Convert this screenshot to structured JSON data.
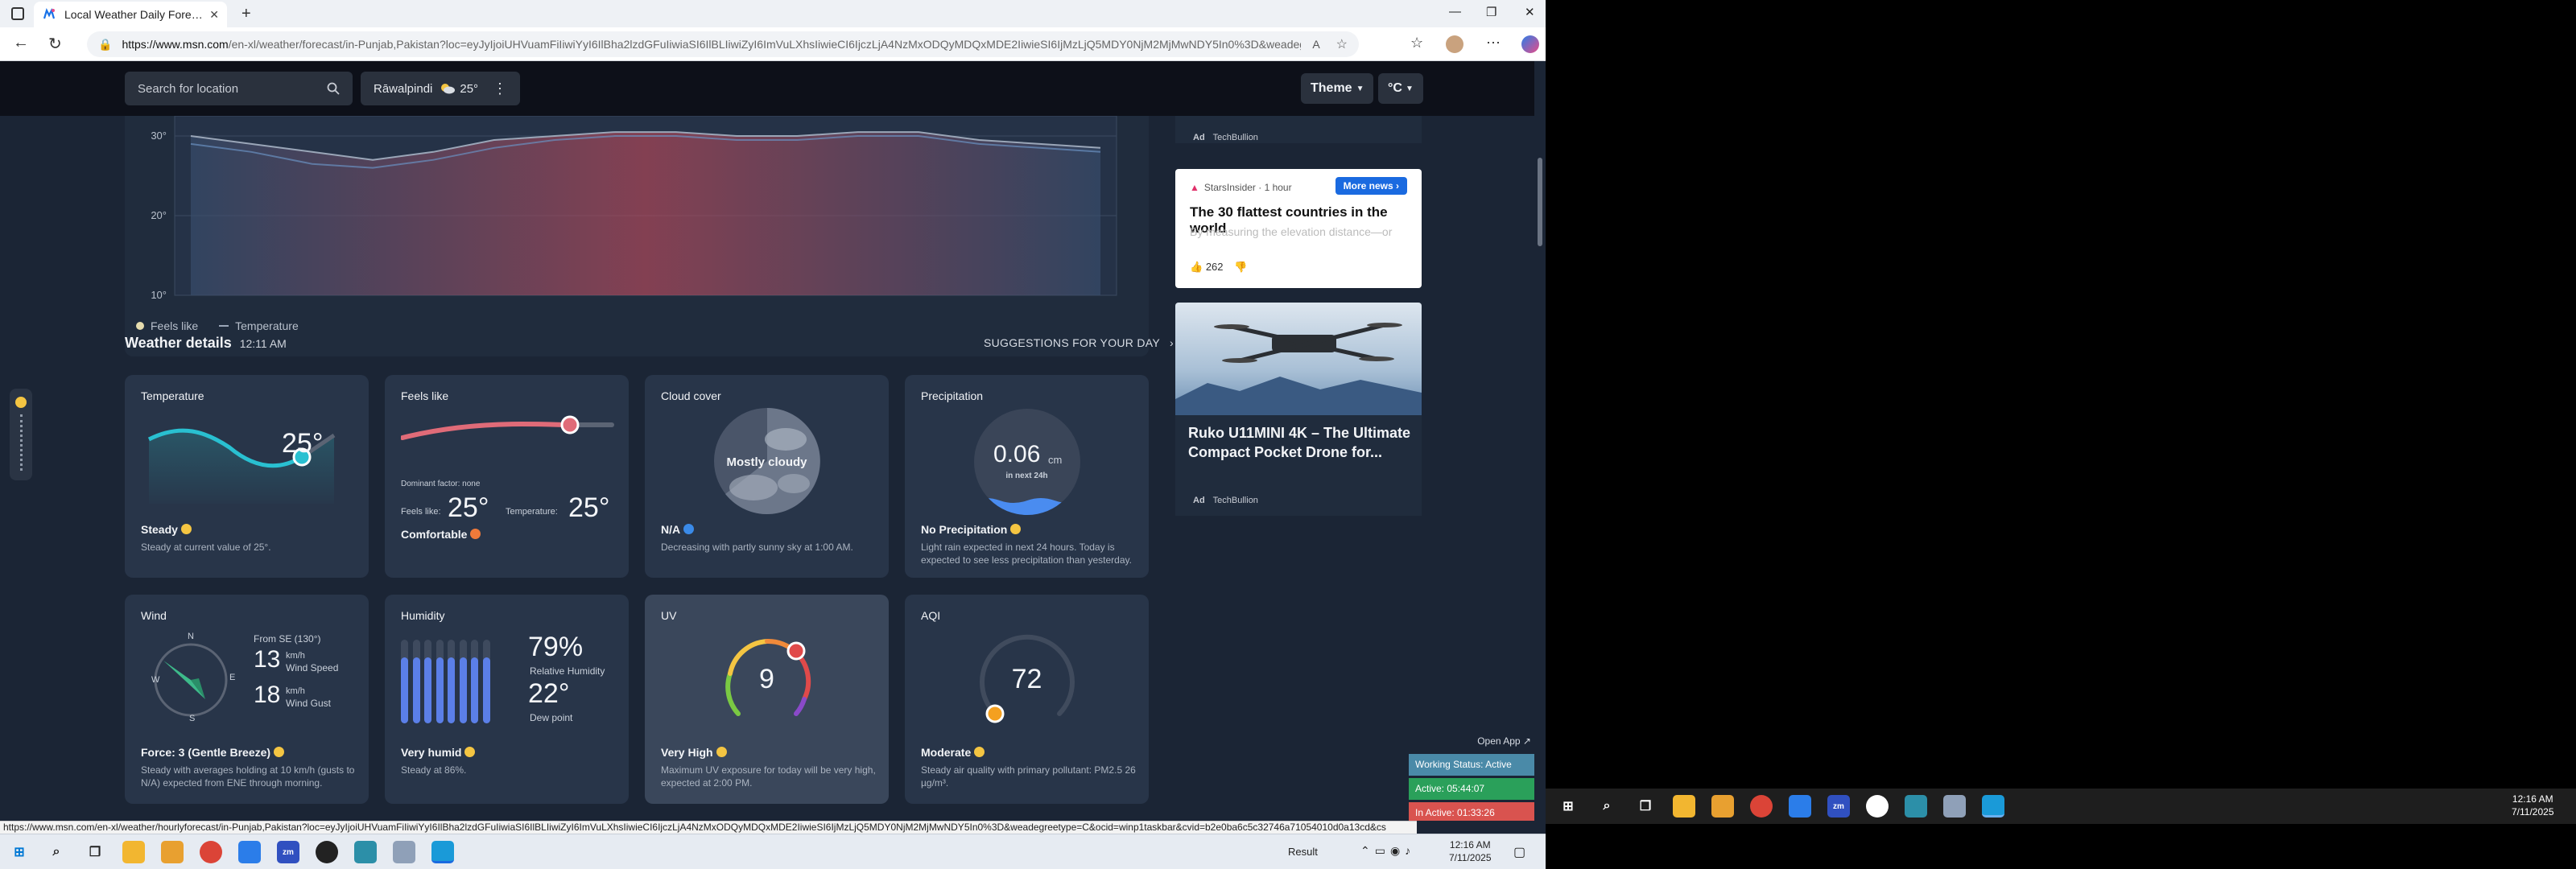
{
  "browser": {
    "tab_title": "Local Weather Daily Forecasts, Ra",
    "tab_close": "✕",
    "new_tab": "+",
    "url_host": "https://www.msn.com",
    "url_path": "/en-xl/weather/forecast/in-Punjab,Pakistan?loc=eyJyIjoiUHVuamFiIiwiYyI6IlBha2lzdGFuIiwiaSI6IlBLIiwiZyI6ImVuLXhsIiwieCI6IjczLjA4NzMxODQyMDQxMDE2IiwieSI6IjMzLjQ5MDY0NjM2MjMwNDY5In0%3D&weadegreet..."
  },
  "header": {
    "search_placeholder": "Search for location",
    "location": "Rāwalpindi",
    "location_temp": "25°",
    "theme_label": "Theme",
    "unit_label": "°C"
  },
  "chart_data": {
    "type": "area",
    "y_ticks": [
      "10°",
      "20°",
      "30°"
    ],
    "ylim": [
      10,
      30
    ],
    "series": [
      {
        "name": "Feels like",
        "values": [
          30,
          29,
          28,
          27,
          28,
          29.5,
          30,
          30.5,
          30.5,
          30,
          30,
          30.5,
          30.5,
          29.5,
          29,
          28.5
        ]
      },
      {
        "name": "Temperature",
        "values": [
          29,
          28,
          26.5,
          26,
          27,
          28.5,
          29.5,
          30,
          30,
          29.5,
          29.5,
          30,
          30,
          29,
          28.5,
          28
        ]
      }
    ],
    "legend": [
      "Feels like",
      "Temperature"
    ]
  },
  "section": {
    "title": "Weather details",
    "time": "12:11 AM",
    "suggestions": "SUGGESTIONS FOR YOUR DAY"
  },
  "cards": {
    "temperature": {
      "title": "Temperature",
      "value": "25°",
      "status": "Steady",
      "desc": "Steady at current value of 25°."
    },
    "feels_like": {
      "title": "Feels like",
      "dominant": "Dominant factor: none",
      "feels_label": "Feels like:",
      "feels_value": "25°",
      "temp_label": "Temperature:",
      "temp_value": "25°",
      "status": "Comfortable"
    },
    "cloud": {
      "title": "Cloud cover",
      "center": "Mostly cloudy",
      "status": "N/A",
      "desc": "Decreasing with partly sunny sky at 1:00 AM."
    },
    "precip": {
      "title": "Precipitation",
      "value": "0.06",
      "unit": "cm",
      "sub": "in next 24h",
      "status": "No Precipitation",
      "desc": "Light rain expected in next 24 hours. Today is expected to see less precipitation than yesterday."
    },
    "wind": {
      "title": "Wind",
      "from": "From SE (130°)",
      "speed": "13",
      "speed_unit": "km/h",
      "speed_label": "Wind Speed",
      "gust": "18",
      "gust_unit": "km/h",
      "gust_label": "Wind Gust",
      "n": "N",
      "s": "S",
      "e": "E",
      "w": "W",
      "status": "Force: 3 (Gentle Breeze)",
      "desc": "Steady with averages holding at 10 km/h (gusts to N/A) expected from ENE through morning."
    },
    "humidity": {
      "title": "Humidity",
      "value": "79%",
      "label": "Relative Humidity",
      "dew": "22°",
      "dew_label": "Dew point",
      "status": "Very humid",
      "desc": "Steady at 86%.",
      "level": 0.79
    },
    "uv": {
      "title": "UV",
      "value": "9",
      "status": "Very High",
      "desc": "Maximum UV exposure for today will be very high, expected at 2:00 PM."
    },
    "aqi": {
      "title": "AQI",
      "value": "72",
      "status": "Moderate",
      "desc": "Steady air quality with primary pollutant: PM2.5 26 µg/m³."
    }
  },
  "ads": {
    "top_ad_tag": "Ad",
    "top_ad_source": "TechBullion",
    "news_source": "StarsInsider · 1 hour",
    "news_button": "More news",
    "news_title": "The 30 flattest countries in the world",
    "news_sub": "By measuring the elevation distance—or",
    "news_likes": "262",
    "drone_title": "Ruko U11MINI 4K – The Ultimate Compact Pocket Drone for...",
    "drone_ad_tag": "Ad",
    "drone_source": "TechBullion"
  },
  "status_url": "https://www.msn.com/en-xl/weather/hourlyforecast/in-Punjab,Pakistan?loc=eyJyIjoiUHVuamFiIiwiYyI6IlBha2lzdGFuIiwiaSI6IlBLIiwiZyI6ImVuLXhsIiwieCI6IjczLjA4NzMxODQyMDQxMDE2IiwieSI6IjMzLjQ5MDY0NjM2MjMwNDY5In0%3D&weadegreetype=C&ocid=winp1taskbar&cvid=b2e0ba6c5c32746a71054010d0a13cd&cs",
  "widget": {
    "open_app": "Open App ↗",
    "working": "Working Status: Active",
    "active": "Active: 05:44:07",
    "inactive": "In Active: 01:33:26"
  },
  "taskbar1": {
    "result": "Result",
    "time": "12:16 AM",
    "date": "7/11/2025"
  },
  "taskbar2": {
    "time": "12:16 AM",
    "date": "7/11/2025"
  },
  "colors": {
    "accent": "#2b7de9",
    "chart_area": "#c24a5a",
    "feels_line": "#e06b78",
    "temp_line": "#29c0d1",
    "humidity_bar": "#5b7fe8"
  }
}
